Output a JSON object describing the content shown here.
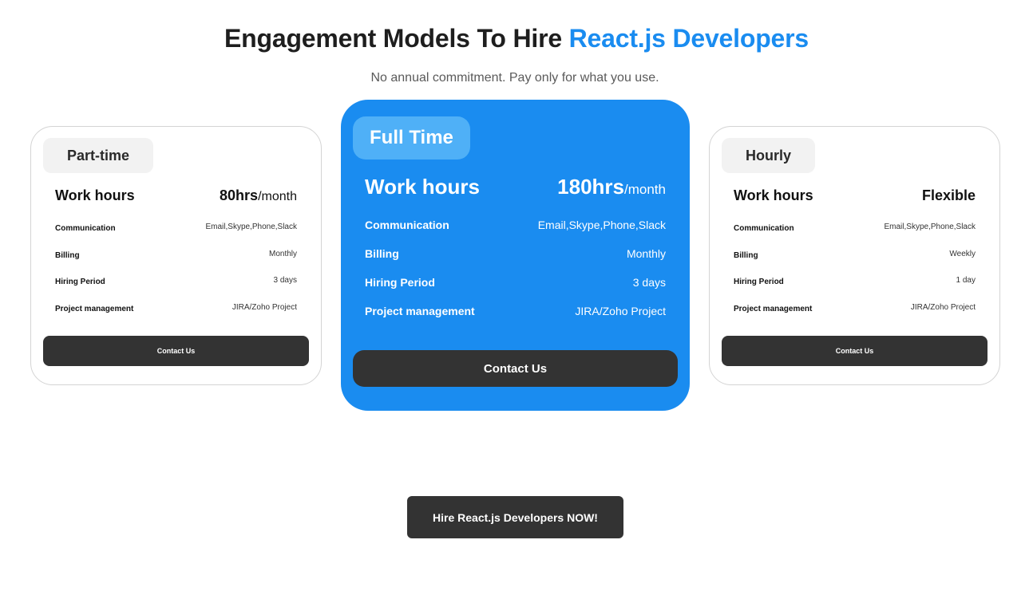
{
  "header": {
    "title_prefix": "Engagement Models To Hire ",
    "title_accent": "React.js Developers",
    "subtitle": "No annual commitment. Pay only for what you use."
  },
  "colors": {
    "accent": "#1a8cf0",
    "dark_button": "#333333",
    "pill_light": "#f2f2f2",
    "pill_featured": "#4fb0f7"
  },
  "plans": [
    {
      "name": "Part-time",
      "work_hours_label": "Work hours",
      "work_hours_value": "80hrs",
      "work_hours_unit": "/month",
      "rows": [
        {
          "label": "Communication",
          "value": "Email,Skype,Phone,Slack"
        },
        {
          "label": "Billing",
          "value": "Monthly"
        },
        {
          "label": "Hiring Period",
          "value": "3 days"
        },
        {
          "label": "Project management",
          "value": "JIRA/Zoho Project"
        }
      ],
      "cta": "Contact Us"
    },
    {
      "name": "Full Time",
      "work_hours_label": "Work hours",
      "work_hours_value": "180hrs",
      "work_hours_unit": "/month",
      "rows": [
        {
          "label": "Communication",
          "value": "Email,Skype,Phone,Slack"
        },
        {
          "label": "Billing",
          "value": "Monthly"
        },
        {
          "label": "Hiring Period",
          "value": "3 days"
        },
        {
          "label": "Project management",
          "value": "JIRA/Zoho Project"
        }
      ],
      "cta": "Contact Us"
    },
    {
      "name": "Hourly",
      "work_hours_label": "Work hours",
      "work_hours_value": "Flexible",
      "work_hours_unit": "",
      "rows": [
        {
          "label": "Communication",
          "value": "Email,Skype,Phone,Slack"
        },
        {
          "label": "Billing",
          "value": "Weekly"
        },
        {
          "label": "Hiring Period",
          "value": "1 day"
        },
        {
          "label": "Project management",
          "value": "JIRA/Zoho Project"
        }
      ],
      "cta": "Contact Us"
    }
  ],
  "footer": {
    "hire_button": "Hire React.js Developers NOW!"
  }
}
